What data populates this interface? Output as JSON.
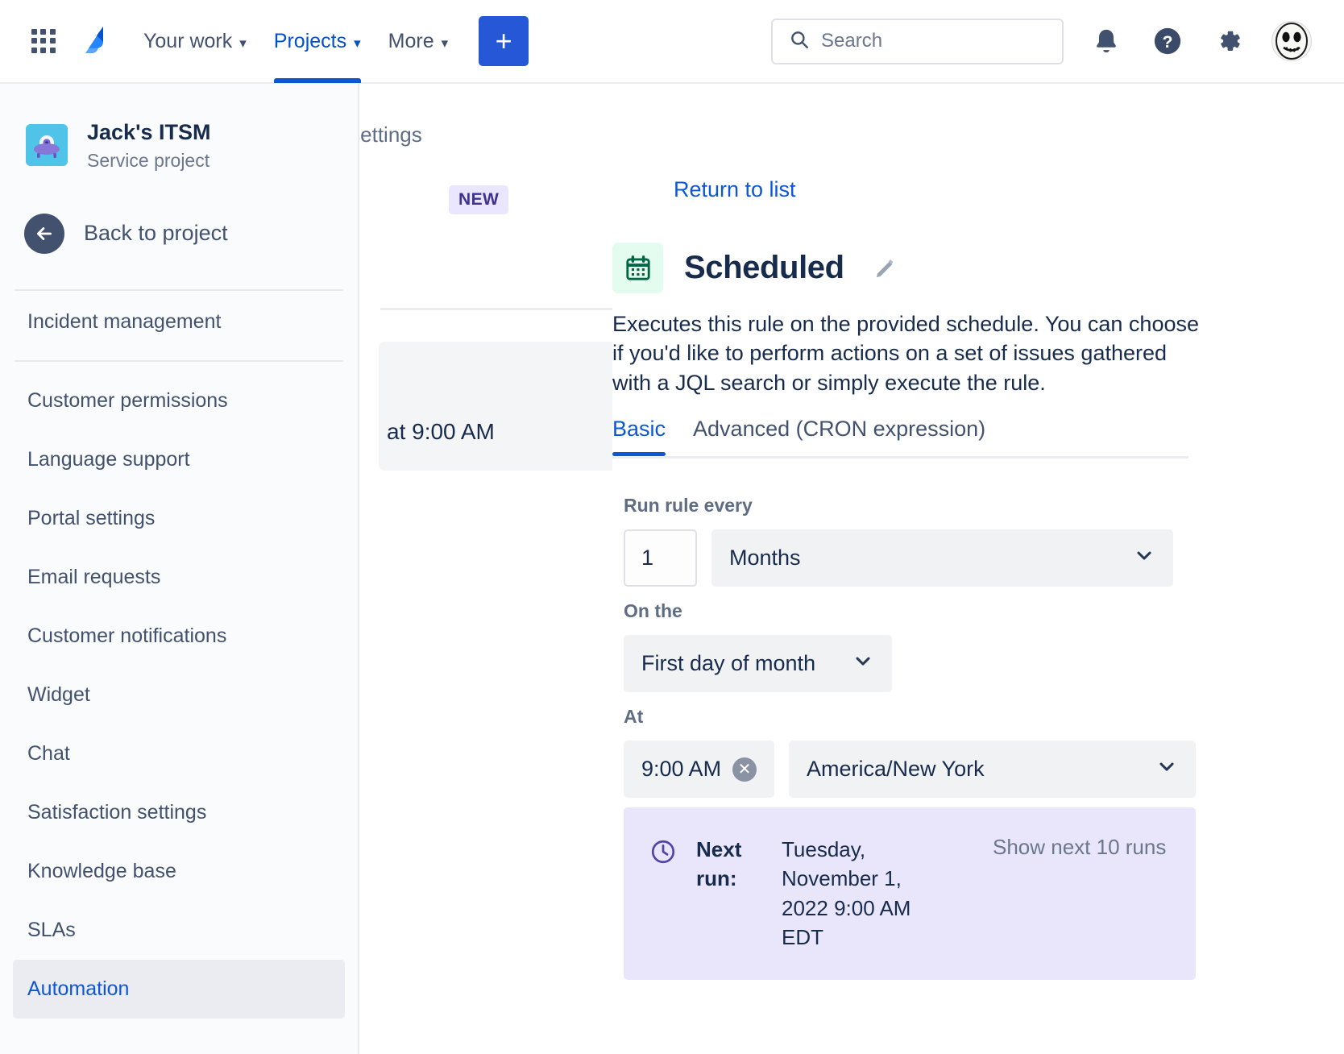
{
  "topnav": {
    "app_switcher_icon": "grid-apps-icon",
    "logo_icon": "jira-logo-icon",
    "links": [
      {
        "label": "Your work",
        "active": false
      },
      {
        "label": "Projects",
        "active": true
      },
      {
        "label": "More",
        "active": false
      }
    ],
    "create_button_label": "+",
    "search": {
      "placeholder": "Search",
      "value": "",
      "icon": "search-icon"
    },
    "notifications_icon": "notification-bell-icon",
    "help_icon": "help-question-icon",
    "settings_icon": "gear-icon",
    "avatar_icon": "user-avatar-skull-face"
  },
  "background": {
    "breadcrumb": "oject settings",
    "new_badge": "NEW",
    "card_text": "at 9:00 AM"
  },
  "sidebar": {
    "project": {
      "name": "Jack's ITSM",
      "type": "Service project",
      "avatar_icon": "project-ufo-avatar"
    },
    "back": {
      "label": "Back to project",
      "icon": "arrow-left-icon"
    },
    "section_item": "Incident management",
    "items": [
      {
        "label": "Customer permissions",
        "selected": false
      },
      {
        "label": "Language support",
        "selected": false
      },
      {
        "label": "Portal settings",
        "selected": false
      },
      {
        "label": "Email requests",
        "selected": false
      },
      {
        "label": "Customer notifications",
        "selected": false
      },
      {
        "label": "Widget",
        "selected": false
      },
      {
        "label": "Chat",
        "selected": false
      },
      {
        "label": "Satisfaction settings",
        "selected": false
      },
      {
        "label": "Knowledge base",
        "selected": false
      },
      {
        "label": "SLAs",
        "selected": false
      },
      {
        "label": "Automation",
        "selected": true
      }
    ]
  },
  "detail": {
    "return_link": "Return to list",
    "component_icon": "calendar-icon",
    "title": "Scheduled",
    "edit_icon": "pencil-edit-icon",
    "description": "Executes this rule on the provided schedule. You can choose if you'd like to perform actions on a set of issues gathered with a JQL search or simply execute the rule.",
    "tabs": [
      {
        "label": "Basic",
        "active": true
      },
      {
        "label": "Advanced (CRON expression)",
        "active": false
      }
    ],
    "run_every": {
      "label": "Run rule every",
      "interval_value": "1",
      "unit_value": "Months"
    },
    "on_the": {
      "label": "On the",
      "value": "First day of month"
    },
    "at": {
      "label": "At",
      "time_value": "9:00 AM",
      "clear_icon": "clear-x-icon",
      "timezone_value": "America/New York"
    },
    "next_run": {
      "icon": "clock-icon",
      "label": "Next run:",
      "value": "Tuesday, November 1, 2022 9:00 AM EDT",
      "show_more": "Show next 10 runs"
    }
  },
  "colors": {
    "brand_blue": "#0c58d4",
    "link_blue": "#0052cc",
    "text_dark": "#172b4d",
    "text_muted": "#6b778c",
    "panel_lavender": "#e9e5fb",
    "badge_purple_bg": "#eae6ff",
    "badge_purple_text": "#403294",
    "calendar_green": "#e3fcef",
    "field_grey": "#f1f2f4"
  }
}
